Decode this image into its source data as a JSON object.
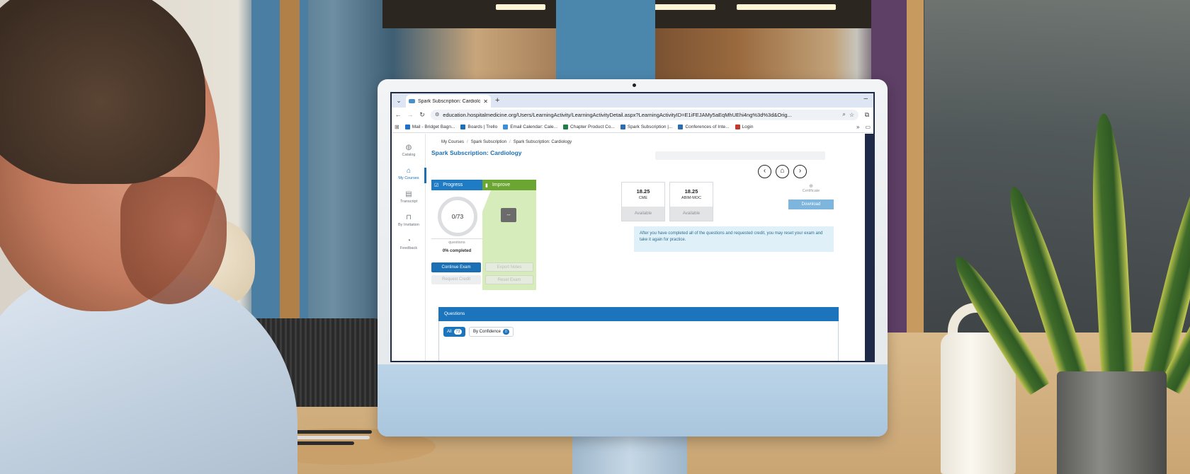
{
  "browser": {
    "tab_title": "Spark Subscription: Cardiology",
    "url": "education.hospitalmedicine.org/Users/LearningActivity/LearningActivityDetail.aspx?LearningActivityID=E1iFEJAMy5aEqMhUEhi4ng%3d%3d&Orig...",
    "bookmarks": [
      {
        "label": "Mail - Bridget Bagn...",
        "color": "#1f6fd1"
      },
      {
        "label": "Boards | Trello",
        "color": "#1d6fb8"
      },
      {
        "label": "Email Calendar: Cale...",
        "color": "#3a8fd6"
      },
      {
        "label": "Chapter Product Co...",
        "color": "#1e7e45"
      },
      {
        "label": "Spark Subscription |...",
        "color": "#2a6db3"
      },
      {
        "label": "Conferences of Inte...",
        "color": "#2a6db3"
      },
      {
        "label": "Login",
        "color": "#c0392b"
      }
    ]
  },
  "sidenav": {
    "items": [
      {
        "label": "Catalog",
        "icon": "globe-icon"
      },
      {
        "label": "My Courses",
        "icon": "home-icon"
      },
      {
        "label": "Transcript",
        "icon": "transcript-icon"
      },
      {
        "label": "By Invitation",
        "icon": "inbox-icon"
      },
      {
        "label": "Feedback",
        "icon": "chat-icon"
      }
    ]
  },
  "breadcrumb": [
    "My Courses",
    "Spark Subscription",
    "Spark Subscription: Cardiology"
  ],
  "page_title": "Spark Subscription: Cardiology",
  "progress": {
    "header": "Progress",
    "ratio": "0/73",
    "answered": 0,
    "total": 73,
    "sub_label": "questions",
    "percent_label": "0% completed",
    "continue_label": "Continue Exam",
    "request_credit_label": "Request Credit"
  },
  "improve": {
    "header": "Improve",
    "value": "--",
    "export_notes_label": "Export Notes",
    "reset_exam_label": "Reset Exam"
  },
  "credits": [
    {
      "value": "18.25",
      "label": "CME",
      "status": "Available"
    },
    {
      "value": "18.25",
      "label": "ABIM-MOC",
      "status": "Available"
    }
  ],
  "certificate": {
    "label": "Certificate",
    "download_label": "Download"
  },
  "info_note": "After you have completed all of the questions and requested credit, you may reset your exam and take it again for practice.",
  "questions": {
    "title": "Questions",
    "filters": [
      {
        "label": "All",
        "count": "73"
      },
      {
        "label": "By Confidence",
        "count": "0"
      }
    ]
  },
  "colors": {
    "brand_blue": "#1a6fb5",
    "improve_green": "#6aa631"
  }
}
